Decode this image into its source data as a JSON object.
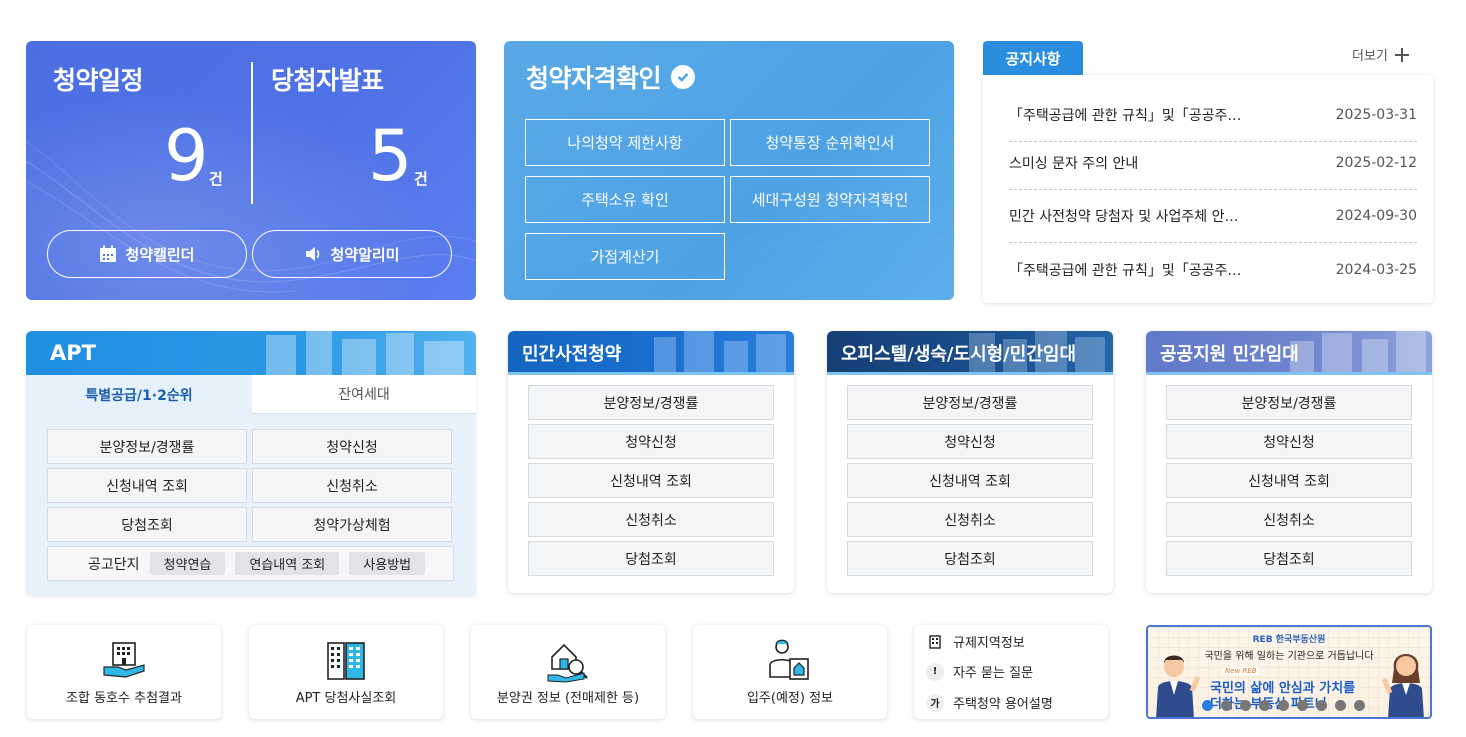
{
  "schedule": {
    "title": "청약일정",
    "count": "9",
    "unit": "건",
    "calendar_btn": "청약캘린더"
  },
  "winners": {
    "title": "당첨자발표",
    "count": "5",
    "unit": "건",
    "alarm_btn": "청약알리미"
  },
  "eligibility": {
    "title": "청약자격확인",
    "buttons": [
      "나의청약 제한사항",
      "청약통장 순위확인서",
      "주택소유 확인",
      "세대구성원 청약자격확인",
      "가점계산기"
    ]
  },
  "notice": {
    "tab": "공지사항",
    "more": "더보기",
    "items": [
      {
        "title": "「주택공급에 관한 규칙」및「공공주…",
        "date": "2025-03-31"
      },
      {
        "title": "스미싱 문자 주의 안내",
        "date": "2025-02-12"
      },
      {
        "title": "민간 사전청약 당첨자 및 사업주체 안…",
        "date": "2024-09-30"
      },
      {
        "title": "「주택공급에 관한 규칙」및「공공주…",
        "date": "2024-03-25"
      }
    ]
  },
  "apt": {
    "title": "APT",
    "tabs": [
      "특별공급/1·2순위",
      "잔여세대"
    ],
    "buttons": [
      "분양정보/경쟁률",
      "청약신청",
      "신청내역 조회",
      "신청취소",
      "당첨조회",
      "청약가상체험"
    ],
    "practice_label": "공고단지",
    "practice_chips": [
      "청약연습",
      "연습내역 조회",
      "사용방법"
    ]
  },
  "categories": [
    {
      "title": "민간사전청약",
      "items": [
        "분양정보/경쟁률",
        "청약신청",
        "신청내역 조회",
        "신청취소",
        "당첨조회"
      ]
    },
    {
      "title": "오피스텔/생숙/도시형/민간임대",
      "items": [
        "분양정보/경쟁률",
        "청약신청",
        "신청내역 조회",
        "신청취소",
        "당첨조회"
      ]
    },
    {
      "title": "공공지원 민간임대",
      "items": [
        "분양정보/경쟁률",
        "청약신청",
        "신청내역 조회",
        "신청취소",
        "당첨조회"
      ]
    }
  ],
  "quick_links": [
    {
      "label": "조합 동호수 추첨결과",
      "icon": "building-hand-icon"
    },
    {
      "label": "APT 당첨사실조회",
      "icon": "apartment-icon"
    },
    {
      "label": "분양권 정보 (전매제한 등)",
      "icon": "house-search-icon"
    },
    {
      "label": "입주(예정) 정보",
      "icon": "person-house-icon"
    }
  ],
  "side_links": [
    {
      "label": "규제지역정보",
      "icon": "building-icon"
    },
    {
      "label": "자주 묻는 질문",
      "icon": "!"
    },
    {
      "label": "주택청약 용어설명",
      "icon": "가"
    }
  ],
  "banner": {
    "logo": "REB 한국부동산원",
    "subtitle": "국민을 위해 일하는 기관으로 거듭납니다",
    "badge": "New REB",
    "headline": "국민의 삶에 안심과 가치를",
    "headline2": "더하는 부동산 파트너",
    "slides": 9,
    "active_slide": 1
  },
  "colors": {
    "schedule_bg": "#4f72e6",
    "eligibility_bg": "#4ea2e4",
    "notice_tab": "#2a8ee0",
    "apt_header": "#1f8fe0",
    "cat1_header": "#1565c0",
    "cat2_header": "#1a4f8f",
    "cat3_header": "#6f86cf"
  }
}
